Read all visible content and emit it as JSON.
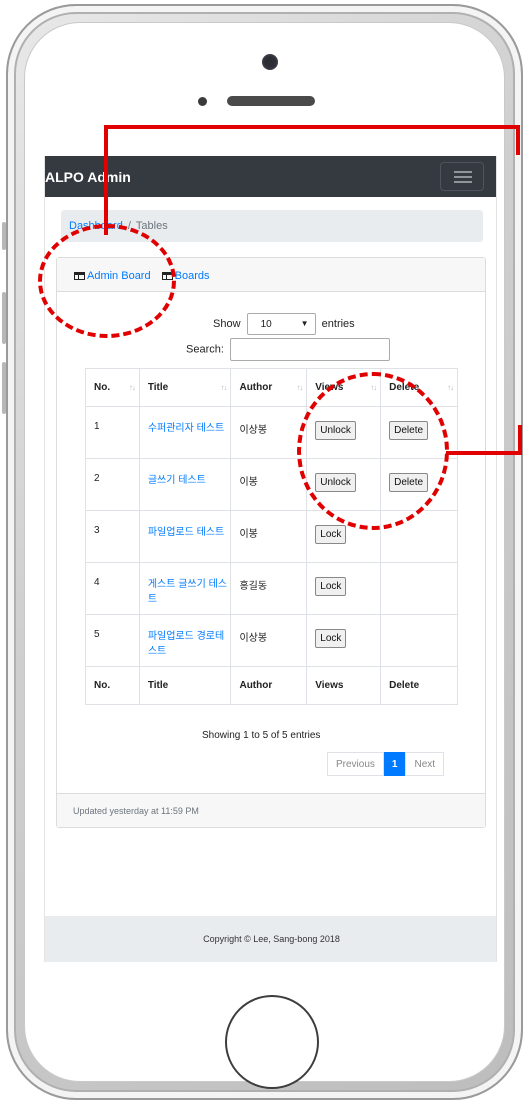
{
  "app": {
    "brand": "ALPO Admin"
  },
  "breadcrumb": {
    "link": "Dashboard",
    "separator": "/",
    "current": "Tables"
  },
  "card": {
    "tabs": [
      {
        "label": "Admin Board"
      },
      {
        "label": "Boards"
      }
    ],
    "show_label": "Show",
    "entries_value": "10",
    "entries_label": "entries",
    "search_label": "Search:",
    "search_value": "",
    "columns": [
      "No.",
      "Title",
      "Author",
      "Views",
      "Delete"
    ],
    "rows": [
      {
        "no": "1",
        "title": "수퍼관리자 테스트",
        "author": "이상봉",
        "views_button": "Unlock",
        "delete_button": "Delete"
      },
      {
        "no": "2",
        "title": "글쓰기 테스트",
        "author": "이봉",
        "views_button": "Unlock",
        "delete_button": "Delete"
      },
      {
        "no": "3",
        "title": "파일업로드 테스트",
        "author": "이봉",
        "views_button": "Lock",
        "delete_button": ""
      },
      {
        "no": "4",
        "title": "게스트 글쓰기 테스트",
        "author": "홍길동",
        "views_button": "Lock",
        "delete_button": ""
      },
      {
        "no": "5",
        "title": "파일업로드 경로테스트",
        "author": "이상봉",
        "views_button": "Lock",
        "delete_button": ""
      }
    ],
    "info": "Showing 1 to 5 of 5 entries",
    "pagination": {
      "previous": "Previous",
      "page": "1",
      "next": "Next"
    },
    "footer_text": "Updated yesterday at 11:59 PM"
  },
  "page_footer": {
    "copyright": "Copyright © Lee, Sang-bong 2018"
  },
  "colors": {
    "navbar": "#343a40",
    "link": "#007bff",
    "annotation": "#e00000"
  },
  "icons": [
    "table-icon",
    "sort-icon",
    "menu-icon"
  ]
}
